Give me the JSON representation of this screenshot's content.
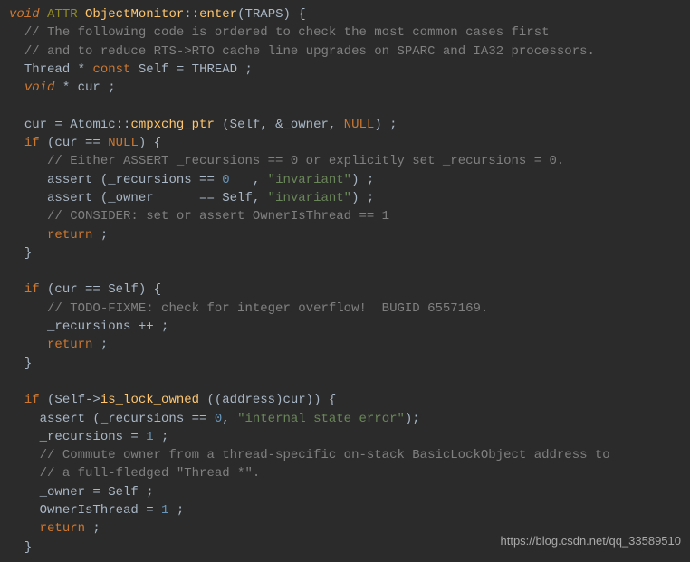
{
  "code": {
    "l1_void": "void",
    "l1_attr": "ATTR",
    "l1_class": "ObjectMonitor",
    "l1_sep": "::",
    "l1_fn": "enter",
    "l1_args_open": "(",
    "l1_traps": "TRAPS",
    "l1_args_close": ") {",
    "l2_cmt": "// The following code is ordered to check the most common cases first",
    "l3_cmt": "// and to reduce RTS->RTO cache line upgrades on SPARC and IA32 processors.",
    "l4_a": "Thread * ",
    "l4_const": "const",
    "l4_b": " Self = THREAD ;",
    "l5_void": "void",
    "l5_b": " * cur ;",
    "l7_a": "cur = Atomic::",
    "l7_fn": "cmpxchg_ptr",
    "l7_b": " (Self, &_owner, ",
    "l7_null": "NULL",
    "l7_c": ") ;",
    "l8_if": "if",
    "l8_a": " (cur == ",
    "l8_null": "NULL",
    "l8_b": ") {",
    "l9_cmt": "// Either ASSERT _recursions == 0 or explicitly set _recursions = 0.",
    "l10_a": "assert (_recursions == ",
    "l10_num": "0",
    "l10_b": "   , ",
    "l10_str": "\"invariant\"",
    "l10_c": ") ;",
    "l11_a": "assert (_owner      == Self, ",
    "l11_str": "\"invariant\"",
    "l11_b": ") ;",
    "l12_cmt": "// CONSIDER: set or assert OwnerIsThread == 1",
    "l13_return": "return",
    "l13_b": " ;",
    "l14_close": "}",
    "l16_if": "if",
    "l16_a": " (cur == Self) {",
    "l17_cmt": "// TODO-FIXME: check for integer overflow!  BUGID 6557169.",
    "l18_a": "_recursions ++ ;",
    "l19_return": "return",
    "l19_b": " ;",
    "l20_close": "}",
    "l22_if": "if",
    "l22_a": " (Self->",
    "l22_fn": "is_lock_owned",
    "l22_b": " ((address)cur)) {",
    "l23_a": "assert (_recursions == ",
    "l23_num": "0",
    "l23_b": ", ",
    "l23_str": "\"internal state error\"",
    "l23_c": ");",
    "l24_a": "_recursions = ",
    "l24_num": "1",
    "l24_b": " ;",
    "l25_cmt": "// Commute owner from a thread-specific on-stack BasicLockObject address to",
    "l26_cmt": "// a full-fledged \"Thread *\".",
    "l27_a": "_owner = Self ;",
    "l28_a": "OwnerIsThread = ",
    "l28_num": "1",
    "l28_b": " ;",
    "l29_return": "return",
    "l29_b": " ;",
    "l30_close": "}"
  },
  "watermark": "https://blog.csdn.net/qq_33589510"
}
